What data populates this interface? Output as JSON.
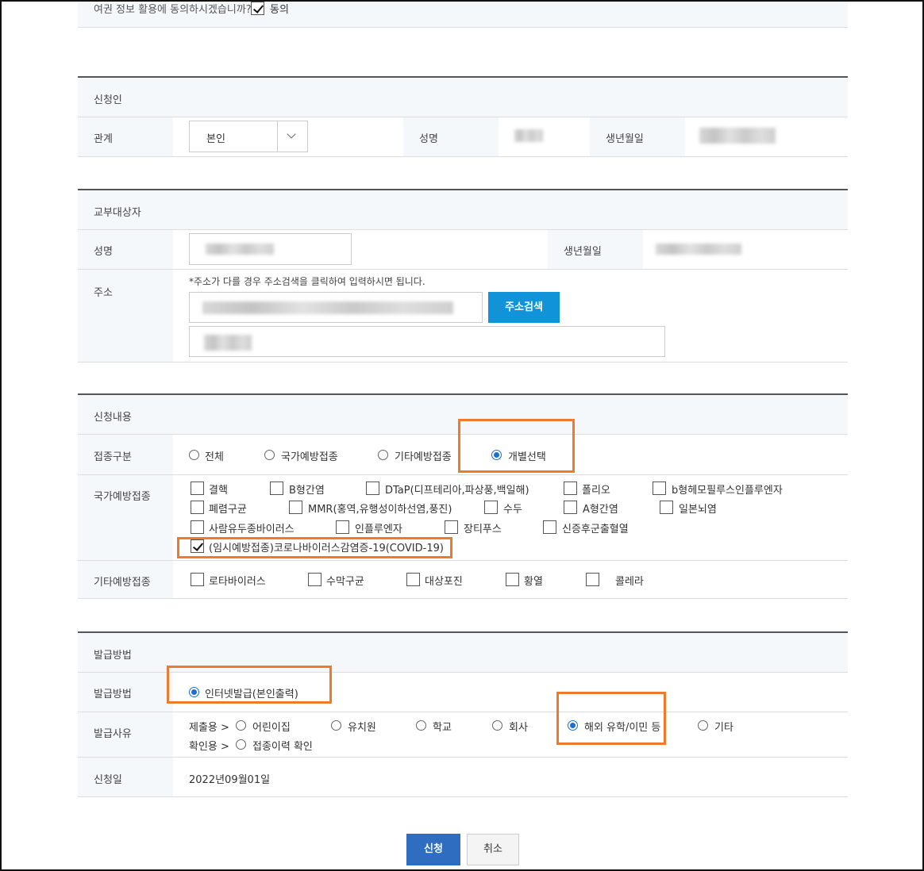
{
  "consent": {
    "question": "여권 정보 활용에 동의하시겠습니까?",
    "agree_label": "동의"
  },
  "applicant": {
    "section_title": "신청인",
    "relation_label": "관계",
    "relation_value": "본인",
    "name_label": "성명",
    "birth_label": "생년월일"
  },
  "recipient": {
    "section_title": "교부대상자",
    "name_label": "성명",
    "birth_label": "생년월일",
    "address_label": "주소",
    "address_note": "*주소가 다를 경우 주소검색을 클릭하여 입력하시면 됩니다.",
    "address_search_button": "주소검색"
  },
  "request": {
    "section_title": "신청내용",
    "type_label": "접종구분",
    "type_options": [
      "전체",
      "국가예방접종",
      "기타예방접종",
      "개별선택"
    ],
    "type_selected": "개별선택",
    "national_label": "국가예방접종",
    "national_options": [
      "결핵",
      "B형간염",
      "DTaP(디프테리아,파상풍,백일해)",
      "폴리오",
      "b형헤모필루스인플루엔자",
      "폐렴구균",
      "MMR(홍역,유행성이하선염,풍진)",
      "수두",
      "A형간염",
      "일본뇌염",
      "사람유두종바이러스",
      "인플루엔자",
      "장티푸스",
      "신증후군출혈열",
      "(임시예방접종)코로나바이러스감염증-19(COVID-19)"
    ],
    "national_checked": "(임시예방접종)코로나바이러스감염증-19(COVID-19)",
    "other_label": "기타예방접종",
    "other_options": [
      "로타바이러스",
      "수막구균",
      "대상포진",
      "황열",
      "콜레라"
    ]
  },
  "issue": {
    "section_title": "발급방법",
    "method_label": "발급방법",
    "method_option": "인터넷발급(본인출력)",
    "reason_label": "발급사유",
    "submit_prefix": "제출용 >",
    "submit_options": [
      "어린이집",
      "유치원",
      "학교",
      "회사",
      "해외 유학/이민 등",
      "기타"
    ],
    "submit_selected": "해외 유학/이민 등",
    "confirm_prefix": "확인용 >",
    "confirm_option": "접종이력 확인",
    "date_label": "신청일",
    "date_value": "2022년09월01일"
  },
  "buttons": {
    "apply": "신청",
    "cancel": "취소"
  },
  "colors": {
    "accent_blue": "#2e6dc0",
    "search_blue": "#1193d9",
    "highlight": "#f07a2c"
  }
}
